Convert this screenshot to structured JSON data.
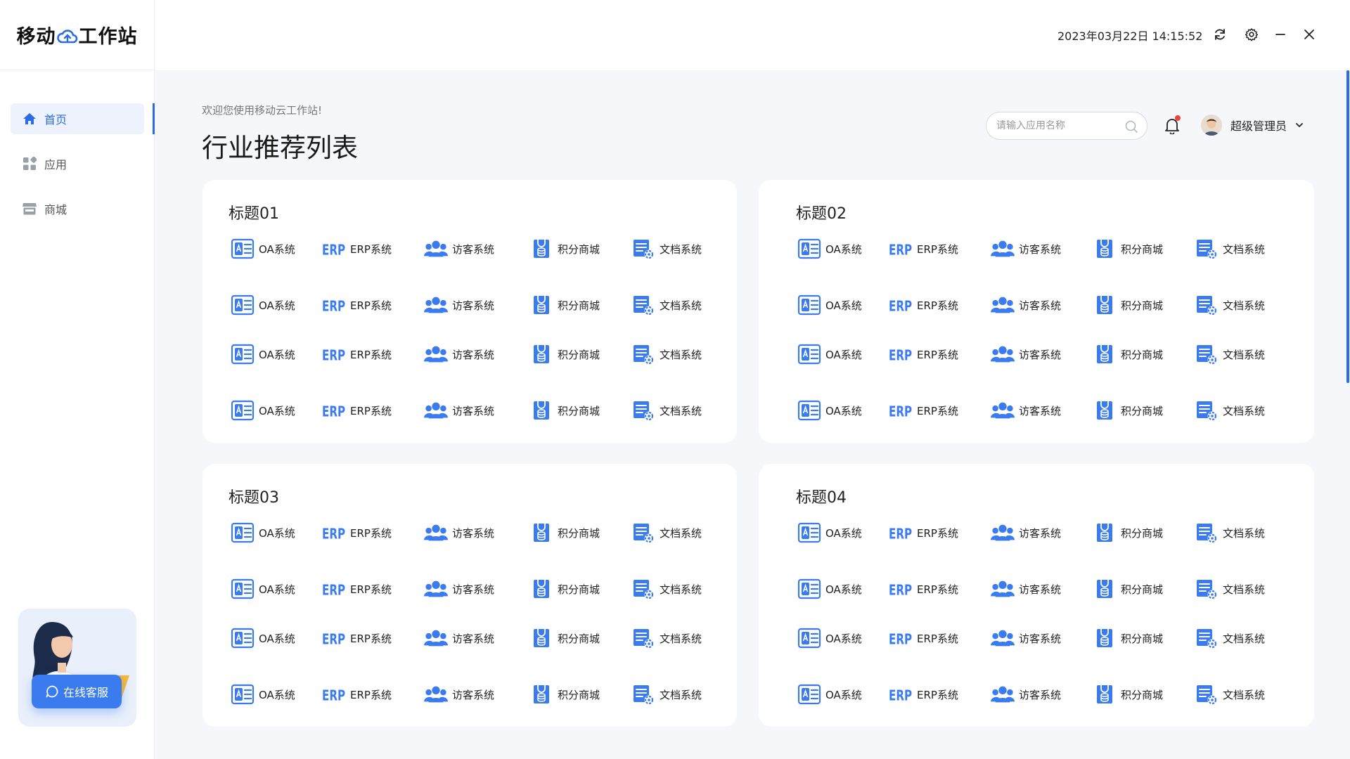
{
  "header": {
    "logo_left": "移动",
    "logo_right": "工作站",
    "datetime": "2023年03月22日 14:15:52"
  },
  "sidebar": {
    "items": [
      {
        "label": "首页",
        "icon": "home-icon",
        "active": true
      },
      {
        "label": "应用",
        "icon": "apps-grid-icon",
        "active": false
      },
      {
        "label": "商城",
        "icon": "store-icon",
        "active": false
      }
    ],
    "customer_service": "在线客服"
  },
  "main": {
    "welcome": "欢迎您使用移动云工作站!",
    "title": "行业推荐列表",
    "search_placeholder": "请输入应用名称",
    "user_name": "超级管理员"
  },
  "apps": [
    {
      "label": "OA系统",
      "icon": "oa-icon"
    },
    {
      "label": "ERP系统",
      "icon": "erp-icon"
    },
    {
      "label": "访客系统",
      "icon": "visitor-icon"
    },
    {
      "label": "积分商城",
      "icon": "points-mall-icon"
    },
    {
      "label": "文档系统",
      "icon": "document-icon"
    }
  ],
  "cards": [
    {
      "title": "标题01"
    },
    {
      "title": "标题02"
    },
    {
      "title": "标题03"
    },
    {
      "title": "标题04"
    }
  ],
  "colors": {
    "accent": "#2b6be6",
    "icon_blue": "#3a7bef",
    "background": "#f5f7fa",
    "notification_dot": "#f04040"
  }
}
